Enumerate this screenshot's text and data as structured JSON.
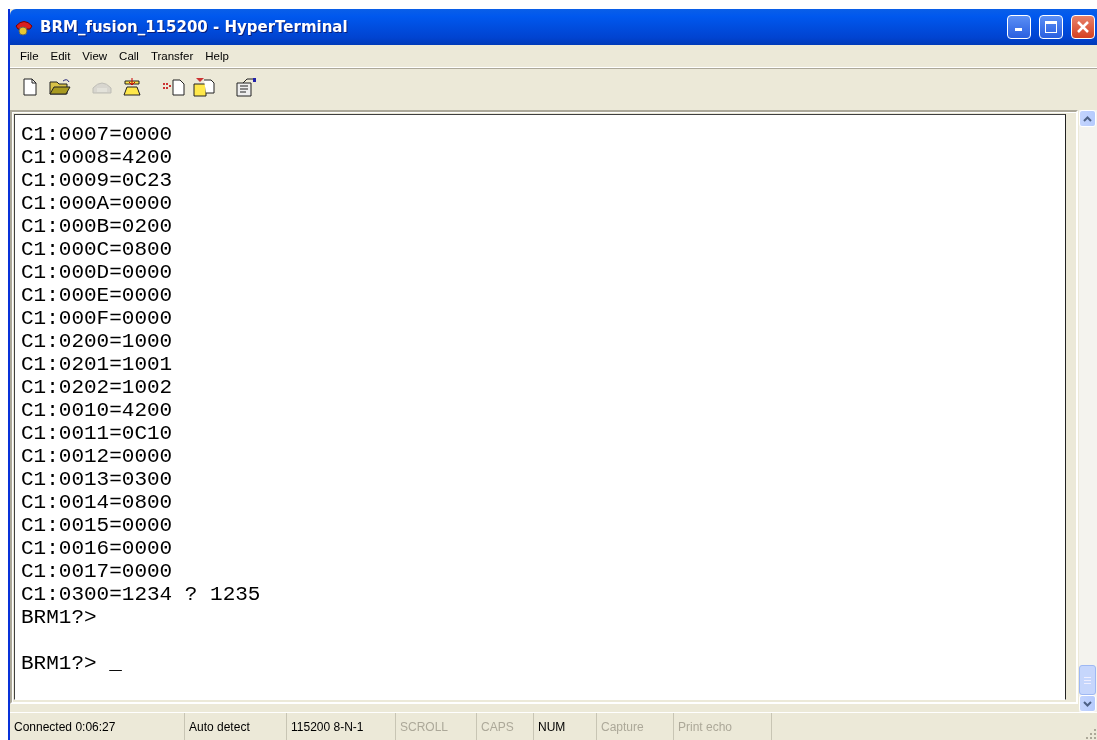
{
  "window": {
    "title": "BRM_fusion_115200 - HyperTerminal"
  },
  "menu": [
    "File",
    "Edit",
    "View",
    "Call",
    "Transfer",
    "Help"
  ],
  "toolbar": [
    {
      "disabled": false
    },
    {
      "disabled": false
    },
    {
      "disabled": true
    },
    {
      "disabled": false
    },
    {
      "disabled": false
    },
    {
      "disabled": false
    },
    {
      "disabled": false
    }
  ],
  "terminal": {
    "output": [
      "C1:0007=0000",
      "C1:0008=4200",
      "C1:0009=0C23",
      "C1:000A=0000",
      "C1:000B=0200",
      "C1:000C=0800",
      "C1:000D=0000",
      "C1:000E=0000",
      "C1:000F=0000",
      "C1:0200=1000",
      "C1:0201=1001",
      "C1:0202=1002",
      "C1:0010=4200",
      "C1:0011=0C10",
      "C1:0012=0000",
      "C1:0013=0300",
      "C1:0014=0800",
      "C1:0015=0000",
      "C1:0016=0000",
      "C1:0017=0000",
      "C1:0300=1234 ? 1235",
      "BRM1?>"
    ],
    "prompt": "BRM1?> _"
  },
  "status_bar": [
    {
      "text": "Connected 0:06:27",
      "disabled": false
    },
    {
      "text": "Auto detect",
      "disabled": false
    },
    {
      "text": "115200 8-N-1",
      "disabled": false
    },
    {
      "text": "SCROLL",
      "disabled": true
    },
    {
      "text": "CAPS",
      "disabled": true
    },
    {
      "text": "NUM",
      "disabled": false
    },
    {
      "text": "Capture",
      "disabled": true
    },
    {
      "text": "Print echo",
      "disabled": true
    }
  ]
}
